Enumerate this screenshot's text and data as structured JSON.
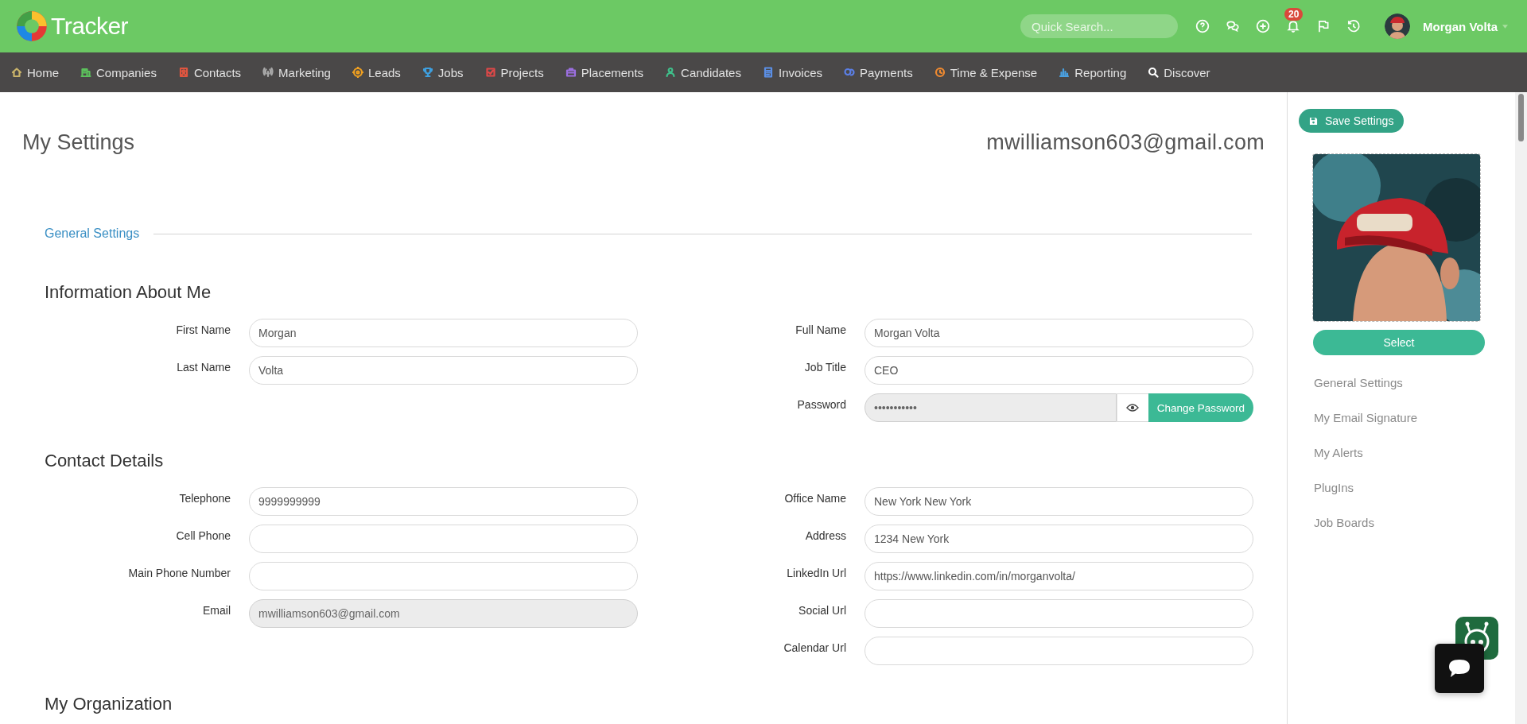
{
  "topbar": {
    "logo": "Tracker",
    "search": {
      "placeholder": "Quick Search..."
    },
    "notifications": "20",
    "user": "Morgan Volta"
  },
  "nav": [
    {
      "label": "Home",
      "color": "#c9b36a"
    },
    {
      "label": "Companies",
      "color": "#5cc25c"
    },
    {
      "label": "Contacts",
      "color": "#e0553f"
    },
    {
      "label": "Marketing",
      "color": "#a9a9a9"
    },
    {
      "label": "Leads",
      "color": "#f0a020"
    },
    {
      "label": "Jobs",
      "color": "#3ea0e0"
    },
    {
      "label": "Projects",
      "color": "#e04848"
    },
    {
      "label": "Placements",
      "color": "#9b6fe0"
    },
    {
      "label": "Candidates",
      "color": "#3fbf8a"
    },
    {
      "label": "Invoices",
      "color": "#5b8fe6"
    },
    {
      "label": "Payments",
      "color": "#5b7fe6"
    },
    {
      "label": "Time & Expense",
      "color": "#f08a30"
    },
    {
      "label": "Reporting",
      "color": "#4aa0e0"
    },
    {
      "label": "Discover",
      "color": "#ffffff"
    }
  ],
  "page": {
    "title": "My Settings",
    "email": "mwilliamson603@gmail.com",
    "section": "General Settings",
    "groups": [
      {
        "heading": "Information About Me",
        "left": [
          {
            "kind": "text",
            "label": "First Name",
            "value": "Morgan",
            "disabled": false
          },
          {
            "kind": "text",
            "label": "Last Name",
            "value": "Volta",
            "disabled": false
          }
        ],
        "right": [
          {
            "kind": "text",
            "label": "Full Name",
            "value": "Morgan Volta",
            "disabled": false
          },
          {
            "kind": "text",
            "label": "Job Title",
            "value": "CEO",
            "disabled": false
          },
          {
            "kind": "password",
            "label": "Password",
            "value": "•••••••••••",
            "disabled": true,
            "button": "Change Password"
          }
        ]
      },
      {
        "heading": "Contact Details",
        "left": [
          {
            "kind": "text",
            "label": "Telephone",
            "value": "9999999999",
            "disabled": false
          },
          {
            "kind": "text",
            "label": "Cell Phone",
            "disabled": false
          },
          {
            "kind": "text",
            "label": "Main Phone Number",
            "disabled": false
          },
          {
            "kind": "text",
            "label": "Email",
            "value": "mwilliamson603@gmail.com",
            "disabled": true
          }
        ],
        "right": [
          {
            "kind": "text",
            "label": "Office Name",
            "value": "New York New York",
            "disabled": false
          },
          {
            "kind": "text",
            "label": "Address",
            "value": "1234 New York",
            "disabled": false
          },
          {
            "kind": "text",
            "label": "LinkedIn Url",
            "value": "https://www.linkedin.com/in/morganvolta/",
            "disabled": false
          },
          {
            "kind": "text",
            "label": "Social Url",
            "disabled": false
          },
          {
            "kind": "text",
            "label": "Calendar Url",
            "disabled": false
          }
        ]
      },
      {
        "heading": "My Organization"
      }
    ]
  },
  "sidebar": {
    "save": "Save Settings",
    "select": "Select",
    "links": [
      "General Settings",
      "My Email Signature",
      "My Alerts",
      "PlugIns",
      "Job Boards"
    ]
  }
}
